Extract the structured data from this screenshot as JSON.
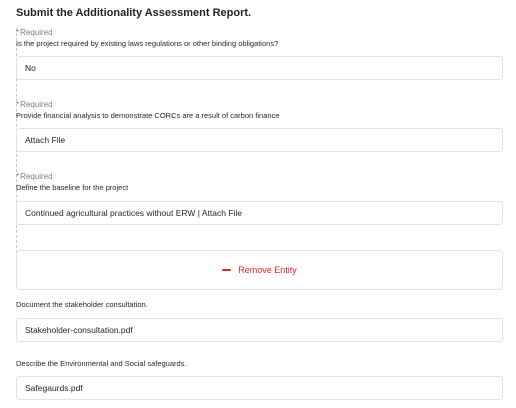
{
  "title": "Submit the Additionality Assessment Report.",
  "required_label": "Required",
  "q1": {
    "question": "Is the project required by existing laws regulations or other binding obligations?",
    "value": "No"
  },
  "q2": {
    "question": "Provide financial analysis to demonstrate CORCs are a result of carbon finance",
    "value": "Attach File"
  },
  "q3": {
    "question": "Define the baseline for the project",
    "value": "Continued agricultural practices without ERW | Attach File"
  },
  "remove_entity_label": "Remove Entity",
  "stakeholder": {
    "label": "Document the stakeholder consultation.",
    "value": "Stakeholder-consultation.pdf"
  },
  "safeguards": {
    "label": "Describe the Environmental and Social safeguards.",
    "value": "Safegaurds.pdf"
  },
  "colors": {
    "danger": "#e0262d",
    "border": "#e1e3e6",
    "muted": "#7a7f86"
  }
}
